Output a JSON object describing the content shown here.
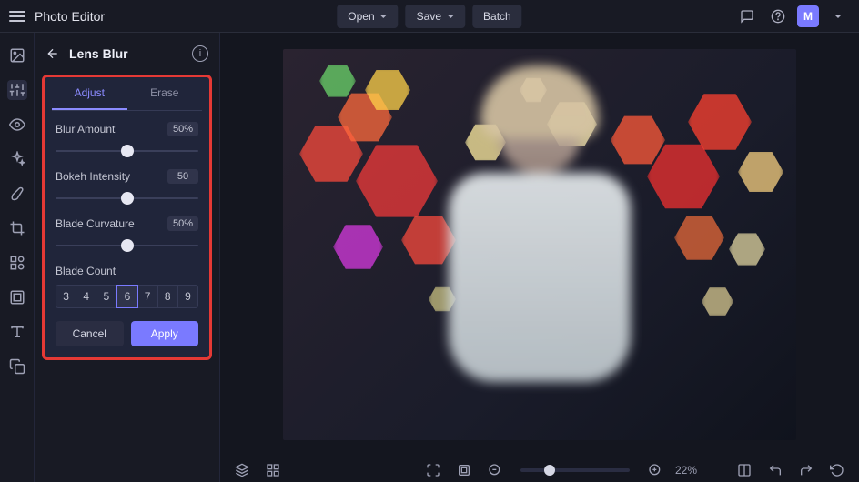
{
  "app": {
    "title": "Photo Editor"
  },
  "header": {
    "open": "Open",
    "save": "Save",
    "batch": "Batch",
    "avatar_initial": "M"
  },
  "panel": {
    "title": "Lens Blur",
    "tabs": {
      "adjust": "Adjust",
      "erase": "Erase",
      "active": "adjust"
    },
    "blur_amount": {
      "label": "Blur Amount",
      "value": "50%",
      "pct": 50
    },
    "bokeh_intensity": {
      "label": "Bokeh Intensity",
      "value": "50",
      "pct": 50
    },
    "blade_curvature": {
      "label": "Blade Curvature",
      "value": "50%",
      "pct": 50
    },
    "blade_count": {
      "label": "Blade Count",
      "options": [
        "3",
        "4",
        "5",
        "6",
        "7",
        "8",
        "9"
      ],
      "selected": "6"
    },
    "cancel": "Cancel",
    "apply": "Apply"
  },
  "statusbar": {
    "zoom_pct": "22%"
  },
  "tool_rail": [
    "image-icon",
    "adjust-icon",
    "eye-icon",
    "sparkle-icon",
    "brush-icon",
    "crop-icon",
    "shapes-icon",
    "frame-icon",
    "text-icon",
    "layers-icon"
  ]
}
